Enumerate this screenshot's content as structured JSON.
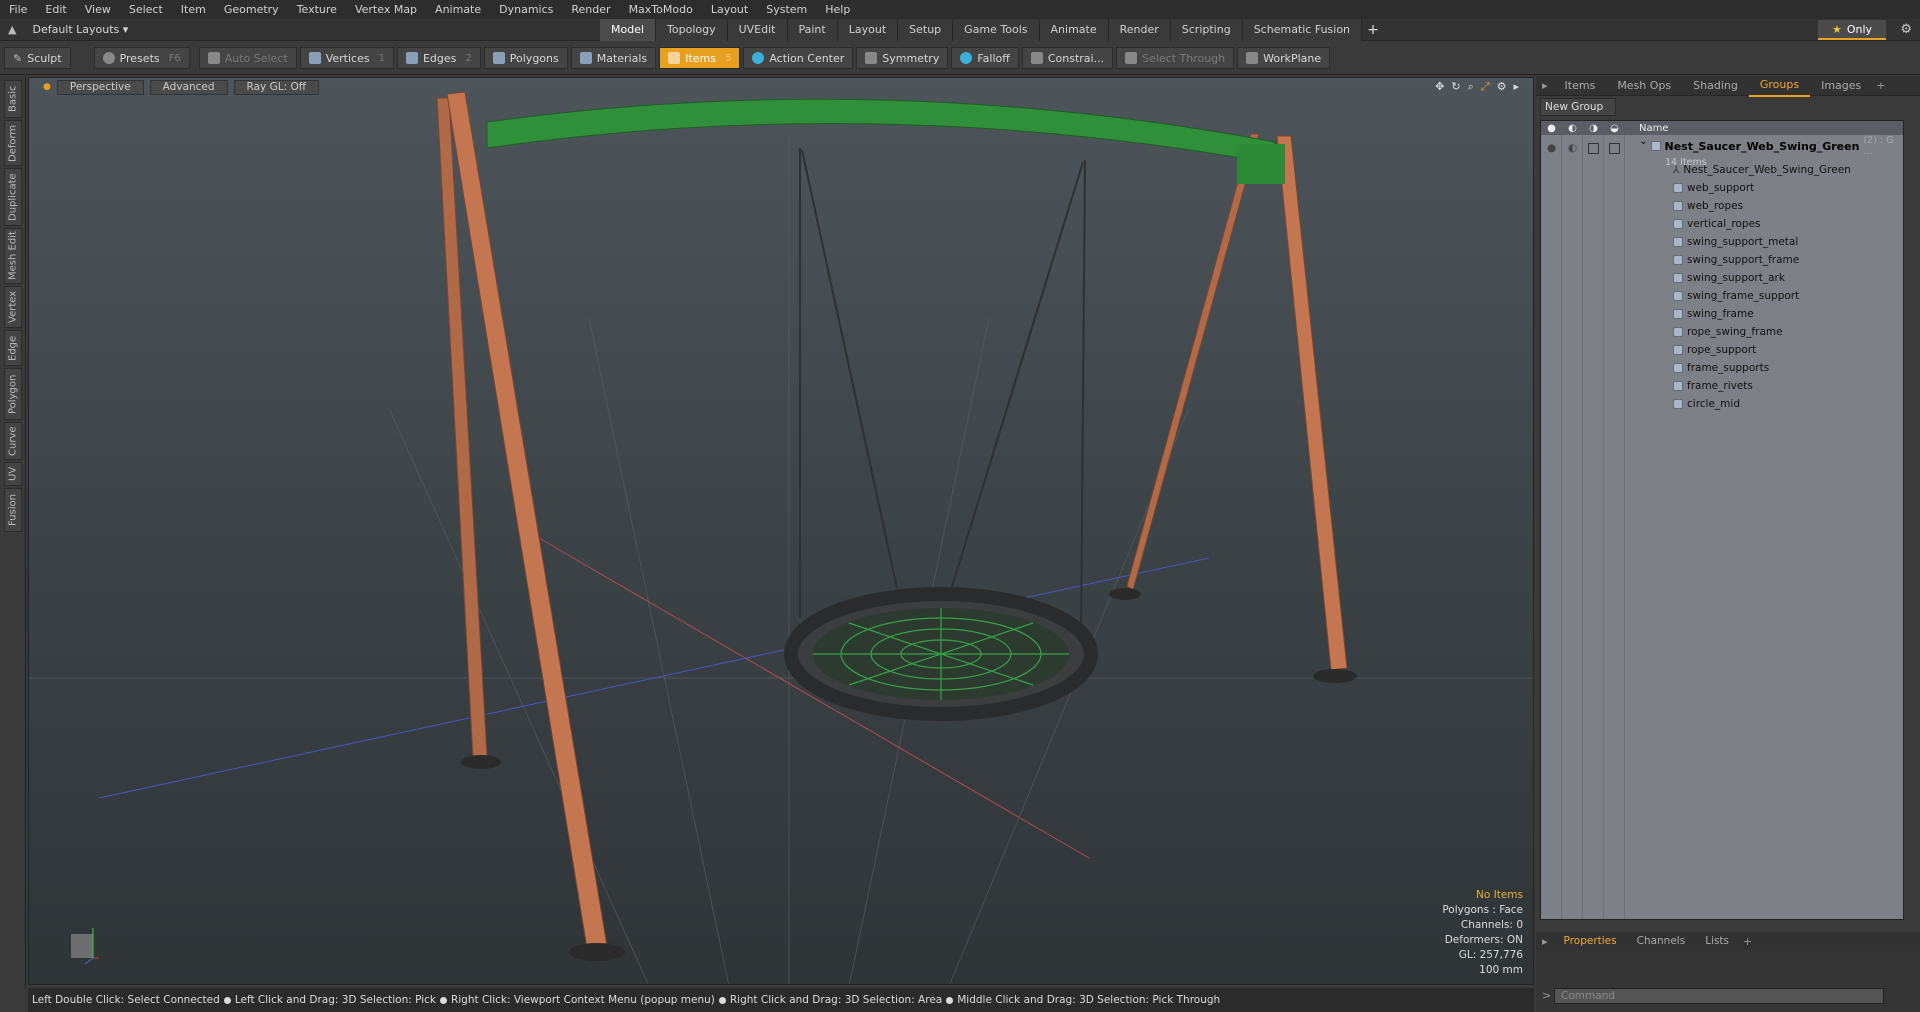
{
  "menu": [
    "File",
    "Edit",
    "View",
    "Select",
    "Item",
    "Geometry",
    "Texture",
    "Vertex Map",
    "Animate",
    "Dynamics",
    "Render",
    "MaxToModo",
    "Layout",
    "System",
    "Help"
  ],
  "layouts": {
    "label": "Default Layouts"
  },
  "mode_tabs": [
    "Model",
    "Topology",
    "UVEdit",
    "Paint",
    "Layout",
    "Setup",
    "Game Tools",
    "Animate",
    "Render",
    "Scripting",
    "Schematic Fusion"
  ],
  "only_label": "Only",
  "toolbar": {
    "sculpt": "Sculpt",
    "presets": "Presets",
    "presets_key": "F6",
    "auto_select": "Auto Select",
    "vertices": "Vertices",
    "vertices_key": "1",
    "edges": "Edges",
    "edges_key": "2",
    "polygons": "Polygons",
    "materials": "Materials",
    "items": "Items",
    "items_key": "5",
    "action_center": "Action Center",
    "symmetry": "Symmetry",
    "falloff": "Falloff",
    "constrain": "Constrai...",
    "select_through": "Select Through",
    "workplane": "WorkPlane"
  },
  "left_tabs": [
    "Basic",
    "Deform",
    "Duplicate",
    "Mesh Edit",
    "Vertex",
    "Edge",
    "Polygon",
    "Curve",
    "UV",
    "Fusion"
  ],
  "viewport": {
    "view": "Perspective",
    "mode": "Advanced",
    "raygl": "Ray GL: Off"
  },
  "stats": {
    "no_items": "No Items",
    "polygons": "Polygons : Face",
    "channels": "Channels: 0",
    "deformers": "Deformers: ON",
    "gl": "GL: 257,776",
    "scale": "100 mm"
  },
  "right_tabs": [
    "Items",
    "Mesh Ops",
    "Shading",
    "Groups",
    "Images"
  ],
  "new_group": "New Group",
  "list_header": "Name",
  "group": {
    "title": "Nest_Saucer_Web_Swing_Green",
    "suffix": "(2) : G ...",
    "count": "14 Items"
  },
  "items": [
    "Nest_Saucer_Web_Swing_Green",
    "web_support",
    "web_ropes",
    "vertical_ropes",
    "swing_support_metal",
    "swing_support_frame",
    "swing_support_ark",
    "swing_frame_support",
    "swing_frame",
    "rope_swing_frame",
    "rope_support",
    "frame_supports",
    "frame_rivets",
    "circle_mid"
  ],
  "bottom_tabs": [
    "Properties",
    "Channels",
    "Lists"
  ],
  "command_placeholder": "Command",
  "status": [
    "Left Double Click: Select Connected",
    "Left Click and Drag: 3D Selection: Pick",
    "Right Click: Viewport Context Menu (popup menu)",
    "Right Click and Drag: 3D Selection: Area",
    "Middle Click and Drag: 3D Selection: Pick Through"
  ]
}
